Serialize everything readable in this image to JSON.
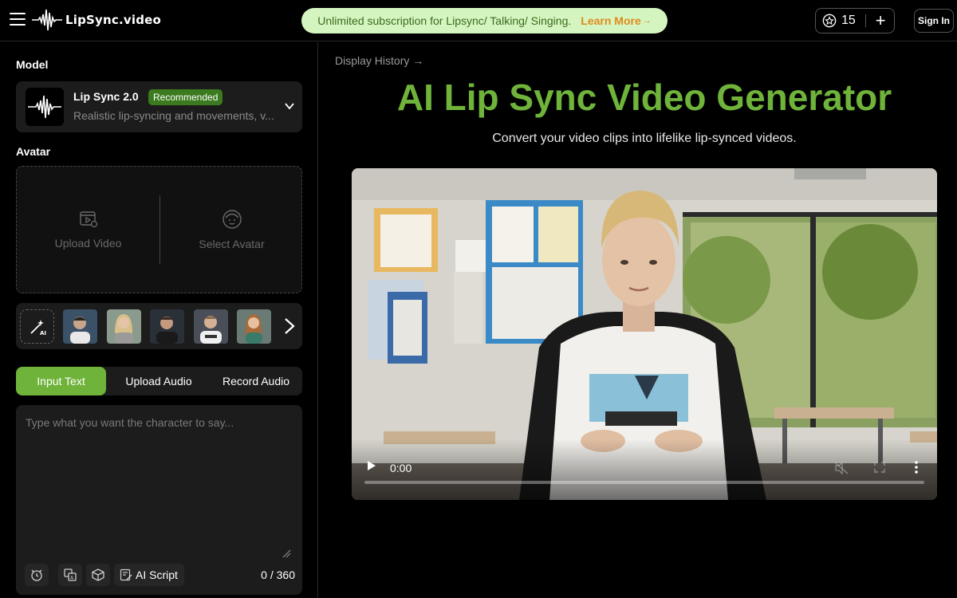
{
  "header": {
    "logo_text": "LipSync.video",
    "promo_text": "Unlimited subscription for Lipsync/ Talking/ Singing.",
    "promo_link": "Learn More",
    "promo_arrow": "→",
    "credits_count": "15",
    "credits_add": "+",
    "signin_label": "Sign In"
  },
  "left": {
    "model_label": "Model",
    "model": {
      "name": "Lip Sync 2.0",
      "badge": "Recommended",
      "description": "Realistic lip-syncing and movements, v..."
    },
    "avatar_label": "Avatar",
    "avatar_options": {
      "upload": "Upload Video",
      "select": "Select Avatar"
    },
    "tabs": [
      "Input Text",
      "Upload Audio",
      "Record Audio"
    ],
    "active_tab": "Input Text",
    "text_input": {
      "placeholder": "Type what you want the character to say...",
      "value": ""
    },
    "ai_script_label": "AI Script",
    "char_counter": "0 / 360"
  },
  "right": {
    "history_link": "Display History →",
    "title": "AI Lip Sync Video Generator",
    "subtitle": "Convert your video clips into lifelike lip-synced videos.",
    "video": {
      "time": "0:00",
      "progress": 0
    }
  },
  "colors": {
    "accent": "#6fb33a",
    "promo_bg": "#d4f5bf",
    "promo_text": "#3a6b1f",
    "promo_link": "#e08a1e",
    "badge_bg": "#3b7a1e",
    "panel_bg": "#1c1c1c"
  }
}
